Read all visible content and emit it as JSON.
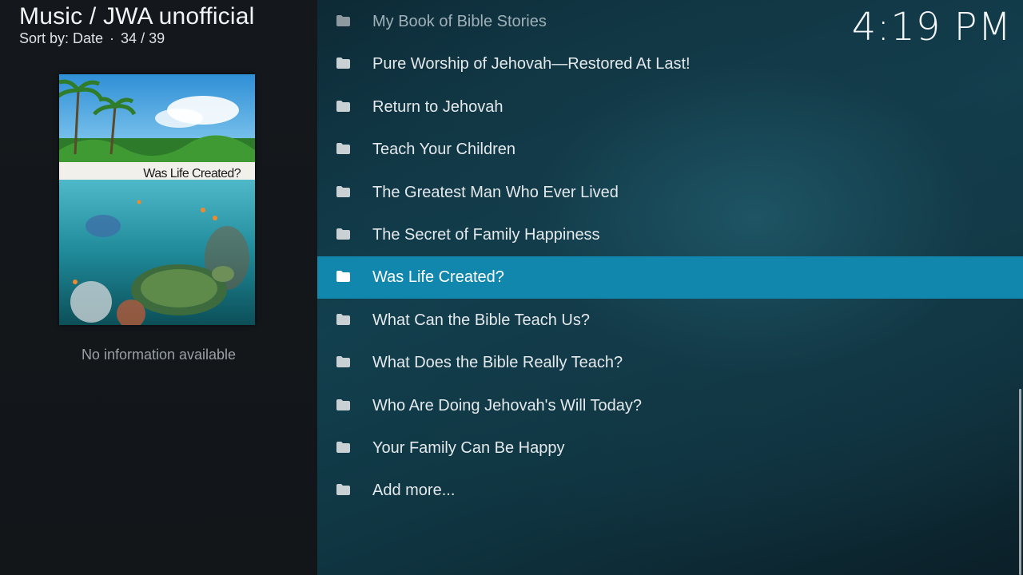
{
  "header": {
    "title": "Music / JWA unofficial",
    "sort_label": "Sort by: Date",
    "separator": "·",
    "position": "34 / 39"
  },
  "clock": "4:19 PM",
  "poster": {
    "title_text": "Was Life Created?"
  },
  "info_text": "No information available",
  "list": {
    "items": [
      {
        "label": "My Book of Bible Stories"
      },
      {
        "label": "Pure Worship of Jehovah—Restored At Last!"
      },
      {
        "label": "Return to Jehovah"
      },
      {
        "label": "Teach Your Children"
      },
      {
        "label": "The Greatest Man Who Ever Lived"
      },
      {
        "label": "The Secret of Family Happiness"
      },
      {
        "label": "Was Life Created?"
      },
      {
        "label": "What Can the Bible Teach Us?"
      },
      {
        "label": "What Does the Bible Really Teach?"
      },
      {
        "label": "Who Are Doing Jehovah's Will Today?"
      },
      {
        "label": "Your Family Can Be Happy"
      },
      {
        "label": "Add more..."
      }
    ],
    "selected_index": 6
  },
  "icons": {
    "item_icon": "folder-icon"
  },
  "colors": {
    "selection": "#1187ad",
    "panel_background": "#14181c"
  }
}
